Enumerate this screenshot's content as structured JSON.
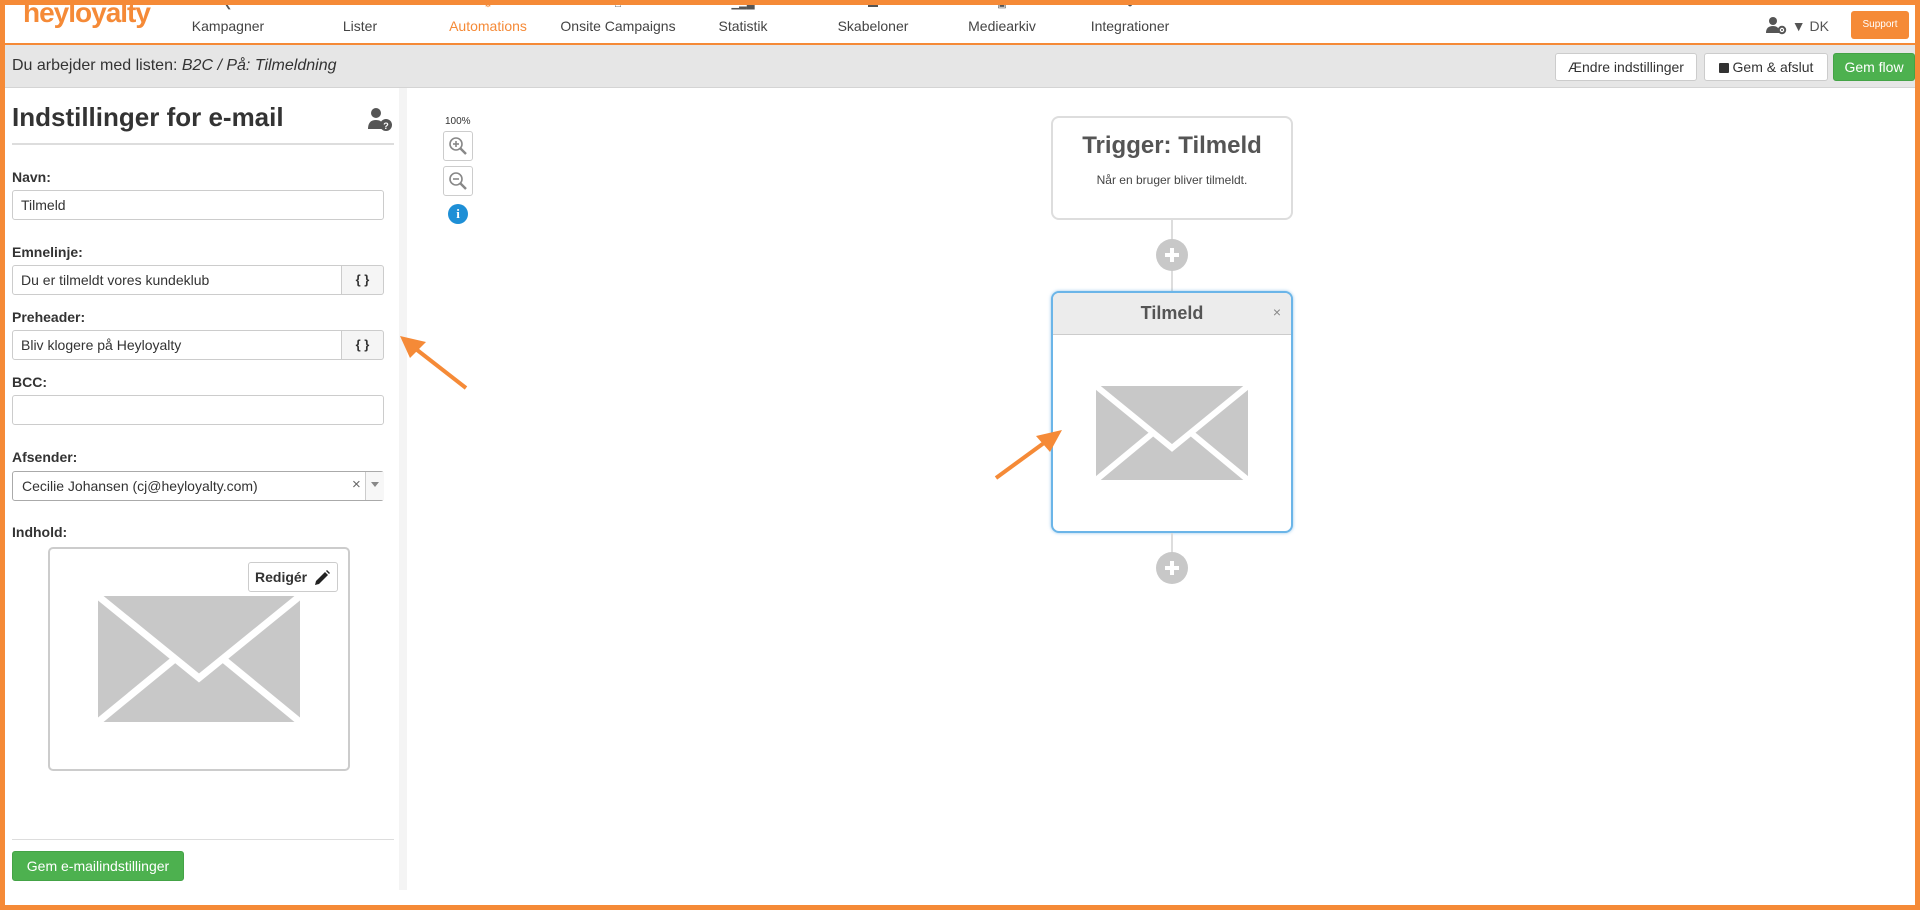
{
  "app": {
    "logo_text": "heyloyalty",
    "nav": [
      {
        "label": "Kampagner"
      },
      {
        "label": "Lister"
      },
      {
        "label": "Automations"
      },
      {
        "label": "Onsite Campaigns"
      },
      {
        "label": "Statistik"
      },
      {
        "label": "Skabeloner"
      },
      {
        "label": "Mediearkiv"
      },
      {
        "label": "Integrationer"
      }
    ],
    "active_nav": "Automations",
    "language": "▼ DK",
    "support_label": "Support",
    "accent_color": "#f58a37"
  },
  "subbar": {
    "prefix": "Du arbejder med listen:",
    "list_name": "B2C",
    "separator": " / På:",
    "trigger_name": "Tilmeldning",
    "settings_button": "Ændre indstillinger",
    "save_exit_button": "Gem & afslut",
    "save_flow_button": "Gem flow",
    "save_color": "#4db14f"
  },
  "panel": {
    "title": "Indstillinger for e-mail",
    "name_label": "Navn:",
    "name_value": "Tilmeld",
    "subject_label": "Emnelinje:",
    "subject_value": "Du er tilmeldt vores kundeklub",
    "preheader_label": "Preheader:",
    "preheader_value": "Bliv klogere på Heyloyalty",
    "placeholder_addon": "{ }",
    "bcc_label": "BCC:",
    "bcc_value": "",
    "sender_label": "Afsender:",
    "sender_value": "Cecilie Johansen (cj@heyloyalty.com)",
    "sender_clear": "×",
    "content_label": "Indhold:",
    "edit_button": "Redigér",
    "save_button": "Gem e-mailindstillinger"
  },
  "canvas": {
    "zoom_level": "100%",
    "info_symbol": "i",
    "trigger": {
      "title": "Trigger: Tilmeld",
      "description": "Når en bruger bliver tilmeldt."
    },
    "email_node": {
      "title": "Tilmeld",
      "close": "×"
    }
  }
}
